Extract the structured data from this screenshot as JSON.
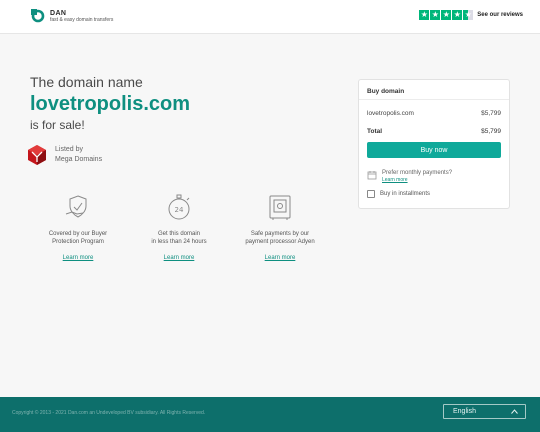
{
  "header": {
    "logo_name": "DAN",
    "logo_tagline": "fast & easy domain transfers",
    "trustpilot_label": "See our reviews",
    "rating_stars": 4.5
  },
  "hero": {
    "line1": "The domain name",
    "domain": "lovetropolis.com",
    "line3": "is for sale!"
  },
  "seller": {
    "listed_by_label": "Listed by",
    "seller_name": "Mega Domains"
  },
  "features": [
    {
      "icon": "shield-hand-icon",
      "text": "Covered by our Buyer\nProtection Program",
      "link": "Learn more"
    },
    {
      "icon": "stopwatch-24-icon",
      "text": "Get this domain\nin less than 24 hours",
      "link": "Learn more"
    },
    {
      "icon": "safe-icon",
      "text": "Safe payments by our\npayment processor Adyen",
      "link": "Learn more"
    }
  ],
  "buy_box": {
    "title": "Buy domain",
    "domain": "lovetropolis.com",
    "domain_price": "$5,799",
    "total_label": "Total",
    "total_price": "$5,799",
    "buy_button": "Buy now",
    "monthly_question": "Prefer monthly payments?",
    "monthly_link": "Learn more",
    "installments_label": "Buy in installments"
  },
  "footer": {
    "copyright": "Copyright © 2013 - 2021 Dan.com an Undeveloped BV subsidiary. All Rights Reserved.",
    "language": "English"
  },
  "colors": {
    "brand_teal": "#0e8f80",
    "button_teal": "#0fa99a",
    "footer_teal": "#0d6f6b",
    "trustpilot_green": "#00b67a",
    "cube_red": "#c4161c"
  }
}
